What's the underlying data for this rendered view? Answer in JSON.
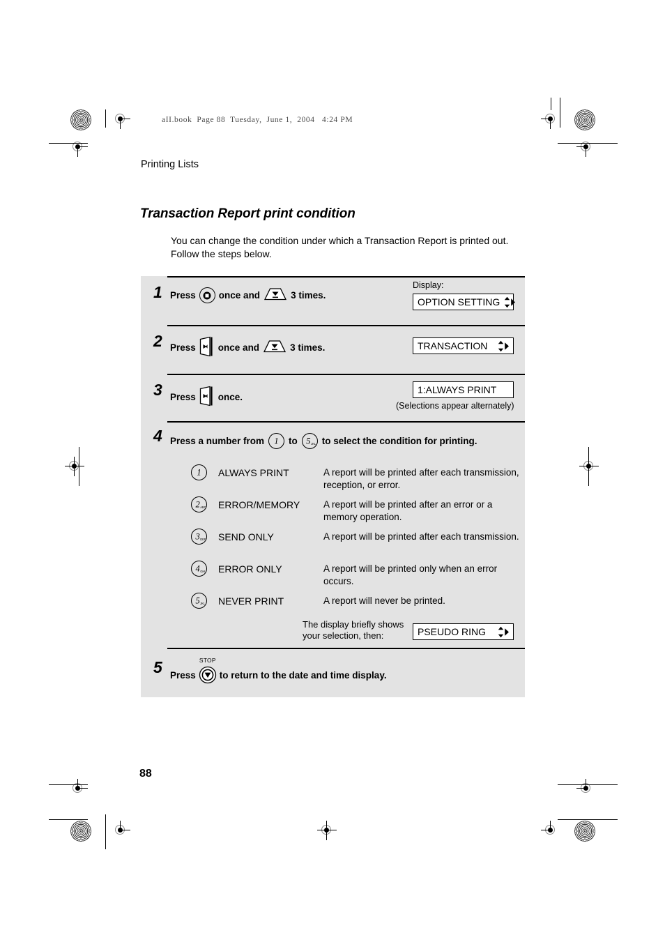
{
  "header": {
    "running_head": "aII.book  Page 88  Tuesday,  June 1,  2004   4:24 PM",
    "section_label": "Printing Lists",
    "title": "Transaction Report print condition",
    "intro": "You can change the condition under which a Transaction Report is printed out. Follow the steps below."
  },
  "steps": [
    {
      "number": "1",
      "press_label": "Press",
      "key1_icon": "function-key-icon",
      "mid_text": "once and",
      "key2_icon": "down-arrow-key-icon",
      "end_text": "3 times.",
      "display_label": "Display:",
      "display_text": "OPTION SETTING"
    },
    {
      "number": "2",
      "press_label": "Press",
      "key1_icon": "right-arrow-key-icon",
      "mid_text": "once and",
      "key2_icon": "down-arrow-key-icon",
      "end_text": "3 times.",
      "display_text": "TRANSACTION"
    },
    {
      "number": "3",
      "press_label": "Press",
      "key1_icon": "right-arrow-key-icon",
      "end_text": "once.",
      "display_text": "1:ALWAYS PRINT",
      "note": "(Selections appear alternately)"
    },
    {
      "number": "4",
      "lead_text": "Press a number from",
      "from_key": "1",
      "to_text": "to",
      "to_key": "5",
      "to_key_sub": "JKL",
      "tail_text": "to select the condition for printing."
    },
    {
      "number": "5",
      "press_label": "Press",
      "key_icon": "stop-key-icon",
      "stop_label": "STOP",
      "end_text": "to return to the date and time display."
    }
  ],
  "options": [
    {
      "key": "1",
      "key_sub": "",
      "name": "ALWAYS PRINT",
      "description": "A report will be printed after each transmission, reception, or error."
    },
    {
      "key": "2",
      "key_sub": "ABC",
      "name": "ERROR/MEMORY",
      "description": "A report will be printed after an error or a memory operation."
    },
    {
      "key": "3",
      "key_sub": "DEF",
      "name": "SEND ONLY",
      "description": "A report will be printed after each transmission."
    },
    {
      "key": "4",
      "key_sub": "GHI",
      "name": "ERROR ONLY",
      "description": "A report will be printed only when an error occurs."
    },
    {
      "key": "5",
      "key_sub": "JKL",
      "name": "NEVER PRINT",
      "description": "A report will never be printed."
    }
  ],
  "brief_display": {
    "text": "The display briefly shows your selection, then:",
    "display_text": "PSEUDO RING"
  },
  "footer": {
    "page_number": "88"
  },
  "colors": {
    "panel_background": "#e3e3e3",
    "text": "#000000",
    "rule": "#000000"
  }
}
